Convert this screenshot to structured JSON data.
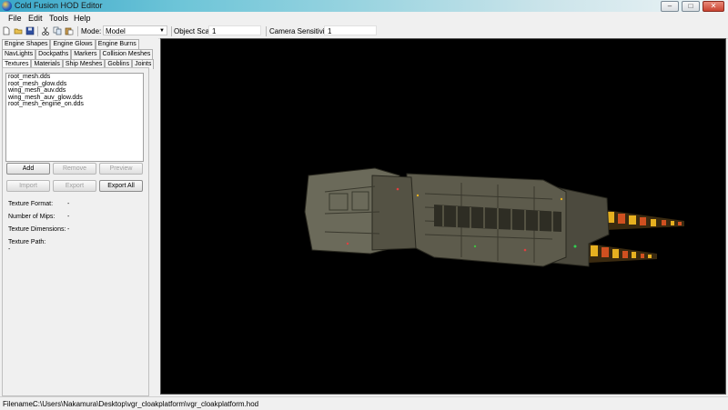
{
  "window": {
    "title": "Cold Fusion HOD Editor",
    "min": "–",
    "max": "□",
    "close": "✕"
  },
  "menu": [
    "File",
    "Edit",
    "Tools",
    "Help"
  ],
  "toolbar": {
    "mode_label": "Mode:",
    "mode_value": "Model",
    "object_scale_label": "Object Scale:",
    "object_scale_value": "1",
    "camera_sensitivity_label": "Camera Sensitivity:",
    "camera_sensitivity_value": "1"
  },
  "tabs": {
    "row1": [
      "Engine Shapes",
      "Engine Glows",
      "Engine Burns"
    ],
    "row2": [
      "NavLights",
      "Dockpaths",
      "Markers",
      "Collision Meshes"
    ],
    "row3": [
      "Textures",
      "Materials",
      "Ship Meshes",
      "Goblins",
      "Joints"
    ],
    "active": "Textures"
  },
  "textures": [
    "root_mesh.dds",
    "root_mesh_glow.dds",
    "wing_mesh_auv.dds",
    "wing_mesh_auv_glow.dds",
    "root_mesh_engine_on.dds"
  ],
  "buttons": {
    "add": "Add",
    "remove": "Remove",
    "preview": "Preview",
    "import": "Import",
    "export": "Export",
    "export_all": "Export All"
  },
  "info": {
    "format_label": "Texture Format:",
    "format_value": "-",
    "mips_label": "Number of Mips:",
    "mips_value": "-",
    "dimensions_label": "Texture Dimensions:",
    "dimensions_value": "-",
    "path_label": "Texture Path:",
    "path_value": "-"
  },
  "status": {
    "label": "Filename:",
    "value": "C:\\Users\\Nakamura\\Desktop\\vgr_cloakplatform\\vgr_cloakplatform.hod"
  },
  "icons": [
    "new-file-icon",
    "open-folder-icon",
    "save-icon",
    "cut-icon",
    "copy-icon",
    "paste-icon"
  ],
  "colors": {
    "viewport_bg": "#000000",
    "hull": "#6b6a5a",
    "engine_glow": "#e6b020"
  }
}
